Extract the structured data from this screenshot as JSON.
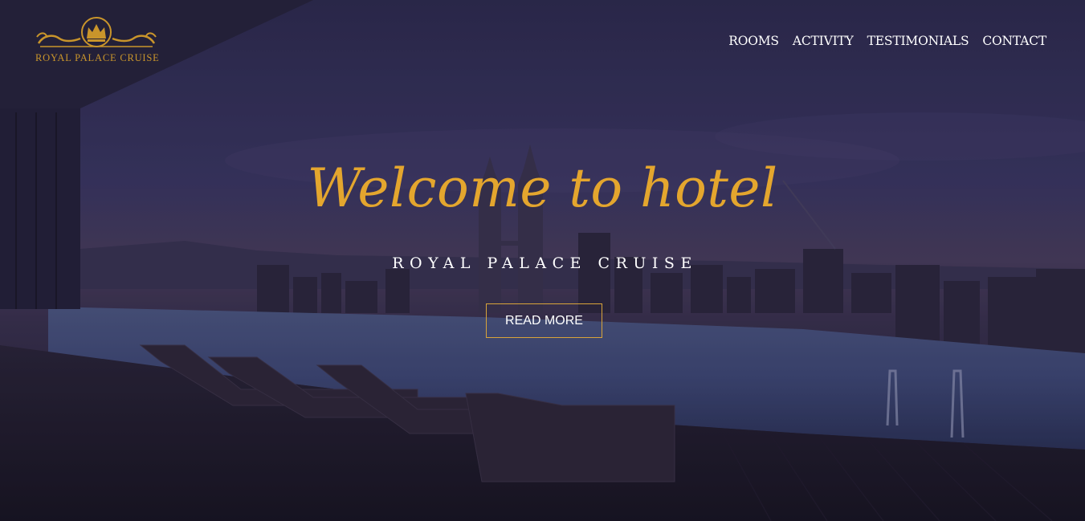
{
  "brand": {
    "logo_text": "ROYAL PALACE CRUISE",
    "accent_color": "#e4a62e"
  },
  "nav": {
    "items": [
      {
        "label": "ROOMS"
      },
      {
        "label": "ACTIVITY"
      },
      {
        "label": "TESTIMONIALS"
      },
      {
        "label": "CONTACT"
      }
    ]
  },
  "hero": {
    "title": "Welcome to hotel",
    "subtitle": "ROYAL PALACE CRUISE",
    "button_label": "READ MORE",
    "background_scene": "rooftop-infinity-pool-city-skyline"
  }
}
